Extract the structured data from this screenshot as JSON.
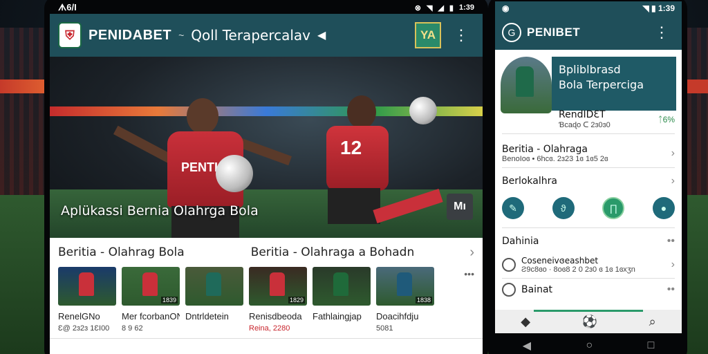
{
  "left_phone": {
    "status": {
      "time_left": "ᗑ6/I",
      "time_right": "1:39",
      "icons": [
        "nfc-icon",
        "wifi-icon",
        "signal-icon",
        "battery-icon"
      ]
    },
    "appbar": {
      "logo_icon": "shield-logo-icon",
      "brand": "PENIDABET",
      "separator": "~",
      "subtitle": "Qoll Terapercalav",
      "send_icon": "send-icon",
      "badge": "YA",
      "menu_icon": "kebab-icon"
    },
    "hero": {
      "title": "Aplükassi Bernia Olahrga Bola",
      "shirt1": "PENTI",
      "shirt2": "12",
      "action_label": "Mı"
    },
    "section": {
      "title": "Beritia - Olahrag Bola",
      "title2": "Beritia - Olahraga a Bohadn"
    },
    "thumbs": [
      {
        "title": "RenelGNo",
        "meta": "Ɛ@ 2ɜ2ɜ 1ƐI00",
        "duration": "",
        "red": false
      },
      {
        "title": "Mer fcorbanON",
        "meta": "8 9 62",
        "duration": "1839",
        "red": false
      },
      {
        "title": "Dntrldetein",
        "meta": "",
        "duration": "",
        "red": false
      },
      {
        "title": "Renisdbeoda",
        "meta": "Reina, 2280",
        "duration": "1829",
        "red": true
      },
      {
        "title": "Fathlaingjap",
        "meta": "",
        "duration": "",
        "red": false
      },
      {
        "title": "Doacihfdju",
        "meta": "5081",
        "duration": "1838",
        "red": false
      }
    ]
  },
  "right_phone": {
    "status": {
      "time": "1:39"
    },
    "appbar": {
      "brand": "PENIBET"
    },
    "card": {
      "line1": "Bpliblbrasd",
      "line2": "Bola Terperciga"
    },
    "info": {
      "title": "RendIDƐT",
      "meta": "Ɓcaɖo ᑕ 2ɜ0ɜ0",
      "pct": "ᛏ6%"
    },
    "row1": {
      "label": "Beritia - Olahraga",
      "meta": "BenoIoɞ • 6hcɞ. 2ɜ23 1ɞ 1ɞ5 2ɞ"
    },
    "row2": {
      "label": "Berlokalhra"
    },
    "row3": {
      "label": "Dahinia"
    },
    "row4": {
      "label": "Coseneivɞeashbet",
      "meta": "Ƨ9c8ɞo · 8oɞ8 2 0 2ɜ0 ɞ 1ɞ 1ɞxʒn"
    },
    "row5": {
      "label": "Bainat"
    }
  }
}
